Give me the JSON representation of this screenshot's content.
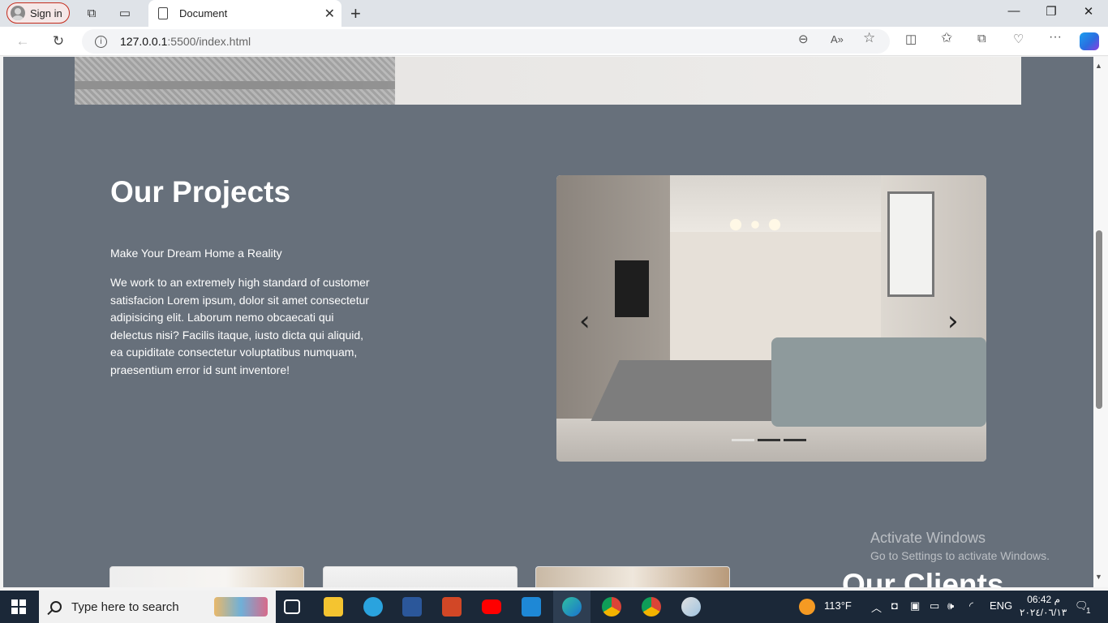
{
  "browser": {
    "signin_label": "Sign in",
    "tab_title": "Document",
    "url_host": "127.0.0.1",
    "url_path": ":5500/index.html"
  },
  "page": {
    "projects_title": "Our Projects",
    "projects_subtitle": "Make Your Dream Home a Reality",
    "projects_description": "We work to an extremely high standard of customer satisfacion Lorem ipsum, dolor sit amet consectetur adipisicing elit. Laborum nemo obcaecati qui delectus nisi? Facilis itaque, iusto dicta qui aliquid, ea cupiditate consectetur voluptatibus numquam, praesentium error id sunt inventore!",
    "clients_title": "Our Clients",
    "carousel": {
      "prev": "‹",
      "next": "›",
      "slides": 3,
      "active_slide": 2
    }
  },
  "watermark": {
    "line1": "Activate Windows",
    "line2": "Go to Settings to activate Windows."
  },
  "taskbar": {
    "search_placeholder": "Type here to search",
    "weather": "113°F",
    "language": "ENG",
    "time": "06:42 م",
    "date": "٢٠٢٤/٠٦/١٣",
    "notification_count": "1"
  },
  "colors": {
    "page_bg": "#67707b",
    "signin_border": "#c42b1c",
    "taskbar": "#1b2838"
  }
}
